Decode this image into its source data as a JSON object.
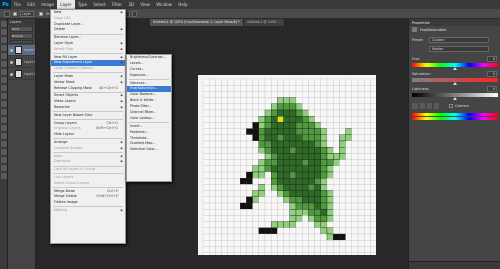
{
  "app": {
    "logo": "Ps"
  },
  "menubar": {
    "items": [
      "File",
      "Edit",
      "Image",
      "Layer",
      "Type",
      "Select",
      "Filter",
      "3D",
      "View",
      "Window",
      "Help"
    ]
  },
  "optbar": {
    "auto_select": "Layer",
    "show_transform": "Show Transform Controls"
  },
  "layers_panel": {
    "title": "Layers",
    "kind_label": "Kind",
    "mode_label": "Normal",
    "layers": [
      {
        "name": "Layer 1",
        "selected": true
      },
      {
        "name": "Layer 0",
        "selected": false
      },
      {
        "name": "Layer 2",
        "selected": false
      }
    ]
  },
  "doc_tabs": [
    {
      "label": "Untitled-1 @ 100% (Hue/Saturation 1, Layer Mask/8) *",
      "active": true
    },
    {
      "label": "Untitled-2 @ 100% ...",
      "active": false
    }
  ],
  "layer_menu": {
    "items": [
      {
        "label": "New",
        "arrow": true
      },
      {
        "label": "Copy CSS",
        "disabled": true
      },
      {
        "label": "Duplicate Layer..."
      },
      {
        "label": "Delete",
        "arrow": true
      },
      {
        "sep": true
      },
      {
        "label": "Rename Layer..."
      },
      {
        "label": "Layer Style",
        "arrow": true
      },
      {
        "label": "Smart Filter",
        "disabled": true,
        "arrow": true
      },
      {
        "sep": true
      },
      {
        "label": "New Fill Layer",
        "arrow": true
      },
      {
        "label": "New Adjustment Layer",
        "arrow": true,
        "highlight": true
      },
      {
        "label": "Layer Content Options...",
        "disabled": true
      },
      {
        "sep": true
      },
      {
        "label": "Layer Mask",
        "arrow": true
      },
      {
        "label": "Vector Mask",
        "arrow": true
      },
      {
        "label": "Release Clipping Mask",
        "shortcut": "Alt+Ctrl+G"
      },
      {
        "sep": true
      },
      {
        "label": "Smart Objects",
        "arrow": true
      },
      {
        "label": "Video Layers",
        "arrow": true
      },
      {
        "label": "Rasterize",
        "arrow": true
      },
      {
        "sep": true
      },
      {
        "label": "New Layer Based Slice"
      },
      {
        "sep": true
      },
      {
        "label": "Group Layers",
        "shortcut": "Ctrl+G"
      },
      {
        "label": "Ungroup Layers",
        "shortcut": "Shift+Ctrl+G",
        "disabled": true
      },
      {
        "label": "Hide Layers"
      },
      {
        "sep": true
      },
      {
        "label": "Arrange",
        "arrow": true
      },
      {
        "label": "Combine Shapes",
        "arrow": true,
        "disabled": true
      },
      {
        "sep": true
      },
      {
        "label": "Align",
        "arrow": true,
        "disabled": true
      },
      {
        "label": "Distribute",
        "arrow": true,
        "disabled": true
      },
      {
        "sep": true
      },
      {
        "label": "Lock All Layers in Group...",
        "disabled": true
      },
      {
        "sep": true
      },
      {
        "label": "Link Layers",
        "disabled": true
      },
      {
        "label": "Select Linked Layers",
        "disabled": true
      },
      {
        "sep": true
      },
      {
        "label": "Merge Down",
        "shortcut": "Ctrl+E"
      },
      {
        "label": "Merge Visible",
        "shortcut": "Shift+Ctrl+E"
      },
      {
        "label": "Flatten Image"
      },
      {
        "sep": true
      },
      {
        "label": "Matting",
        "arrow": true,
        "disabled": true
      }
    ]
  },
  "adjustment_submenu": {
    "items": [
      {
        "label": "Brightness/Contrast..."
      },
      {
        "label": "Levels..."
      },
      {
        "label": "Curves..."
      },
      {
        "label": "Exposure..."
      },
      {
        "sep": true
      },
      {
        "label": "Vibrance..."
      },
      {
        "label": "Hue/Saturation...",
        "highlight": true
      },
      {
        "label": "Color Balance..."
      },
      {
        "label": "Black & White..."
      },
      {
        "label": "Photo Filter..."
      },
      {
        "label": "Channel Mixer..."
      },
      {
        "label": "Color Lookup..."
      },
      {
        "sep": true
      },
      {
        "label": "Invert..."
      },
      {
        "label": "Posterize..."
      },
      {
        "label": "Threshold..."
      },
      {
        "label": "Gradient Map..."
      },
      {
        "label": "Selective Color..."
      }
    ]
  },
  "properties_panel": {
    "tab": "Properties",
    "title": "Hue/Saturation",
    "preset_label": "Preset:",
    "preset_value": "Custom",
    "channel_value": "Master",
    "hue_label": "Hue:",
    "hue_value": 0,
    "saturation_label": "Saturation:",
    "saturation_value": 0,
    "lightness_label": "Lightness:",
    "lightness_value": 0,
    "colorize_label": "Colorize"
  },
  "pixel_art": {
    "colors": {
      "light": "#8fd07a",
      "mid": "#4f9a3e",
      "dark": "#2e6b24",
      "black": "#111111",
      "eye": "#d9e21a"
    },
    "rows": [
      "..........................",
      "..........................",
      "..........................",
      "............LLL...........",
      "...........LMMML..........",
      "..........LMDDDML.........",
      ".........LMDEDDDML........",
      "........KLMDDDDMMML.......",
      ".......KKMDDDDDMMMML...L..",
      "........KMDDMDDDMMML..LL..",
      ".........MMDDDDDDDML..L...",
      ".........LMDDDMDDDDML.L...",
      "..........LMDDDDDDDMLLL...",
      ".........LMMDDDDMDDMML....",
      "........LLMDDDDDDDDML.....",
      ".......KLL.MDDMDDDDML.....",
      "......KK...MDDDDDDML......",
      ".........L.LMDDDDMDL......",
      "........LL..LMDDDDDML.....",
      ".......KL....LMMDDDML.....",
      "......KK......LMMMDML.....",
      "..............LLLMMDL.....",
      "..............LL.LMML.....",
      "...........LLLL...LL......",
      ".........KKK.......LL.....",
      "....................LKK...",
      "..........................",
      ".........................."
    ]
  }
}
